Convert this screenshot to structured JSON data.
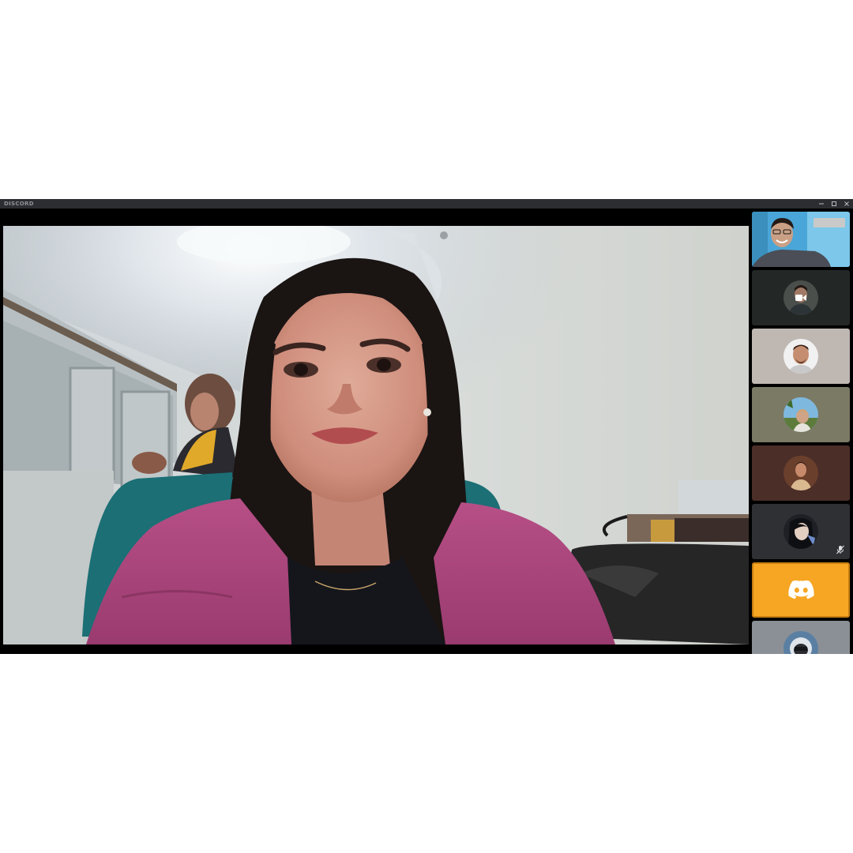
{
  "window": {
    "title": "DISCORD"
  },
  "colors": {
    "titlebar": "#2b2d31",
    "stage_bg": "#000000",
    "highlight_tile": "#f6a623",
    "discord_logo": "#ffffff"
  },
  "main_video": {
    "icon": "participant-video"
  },
  "participants": [
    {
      "kind": "video",
      "icon": "webcam-video-thumbnail",
      "bg": "#4aa6d8"
    },
    {
      "kind": "avatar",
      "icon": "avatar-with-camera-icon",
      "bg": "#232725"
    },
    {
      "kind": "avatar",
      "icon": "avatar",
      "bg": "#bfb7b2"
    },
    {
      "kind": "avatar",
      "icon": "avatar",
      "bg": "#7b7a65"
    },
    {
      "kind": "avatar",
      "icon": "avatar",
      "bg": "#4b2e28"
    },
    {
      "kind": "avatar",
      "icon": "avatar-muted",
      "bg": "#2f3034",
      "muted": true
    },
    {
      "kind": "logo",
      "icon": "discord-logo-icon",
      "bg": "#f6a623"
    },
    {
      "kind": "avatar",
      "icon": "avatar",
      "bg": "#8a9096"
    }
  ]
}
